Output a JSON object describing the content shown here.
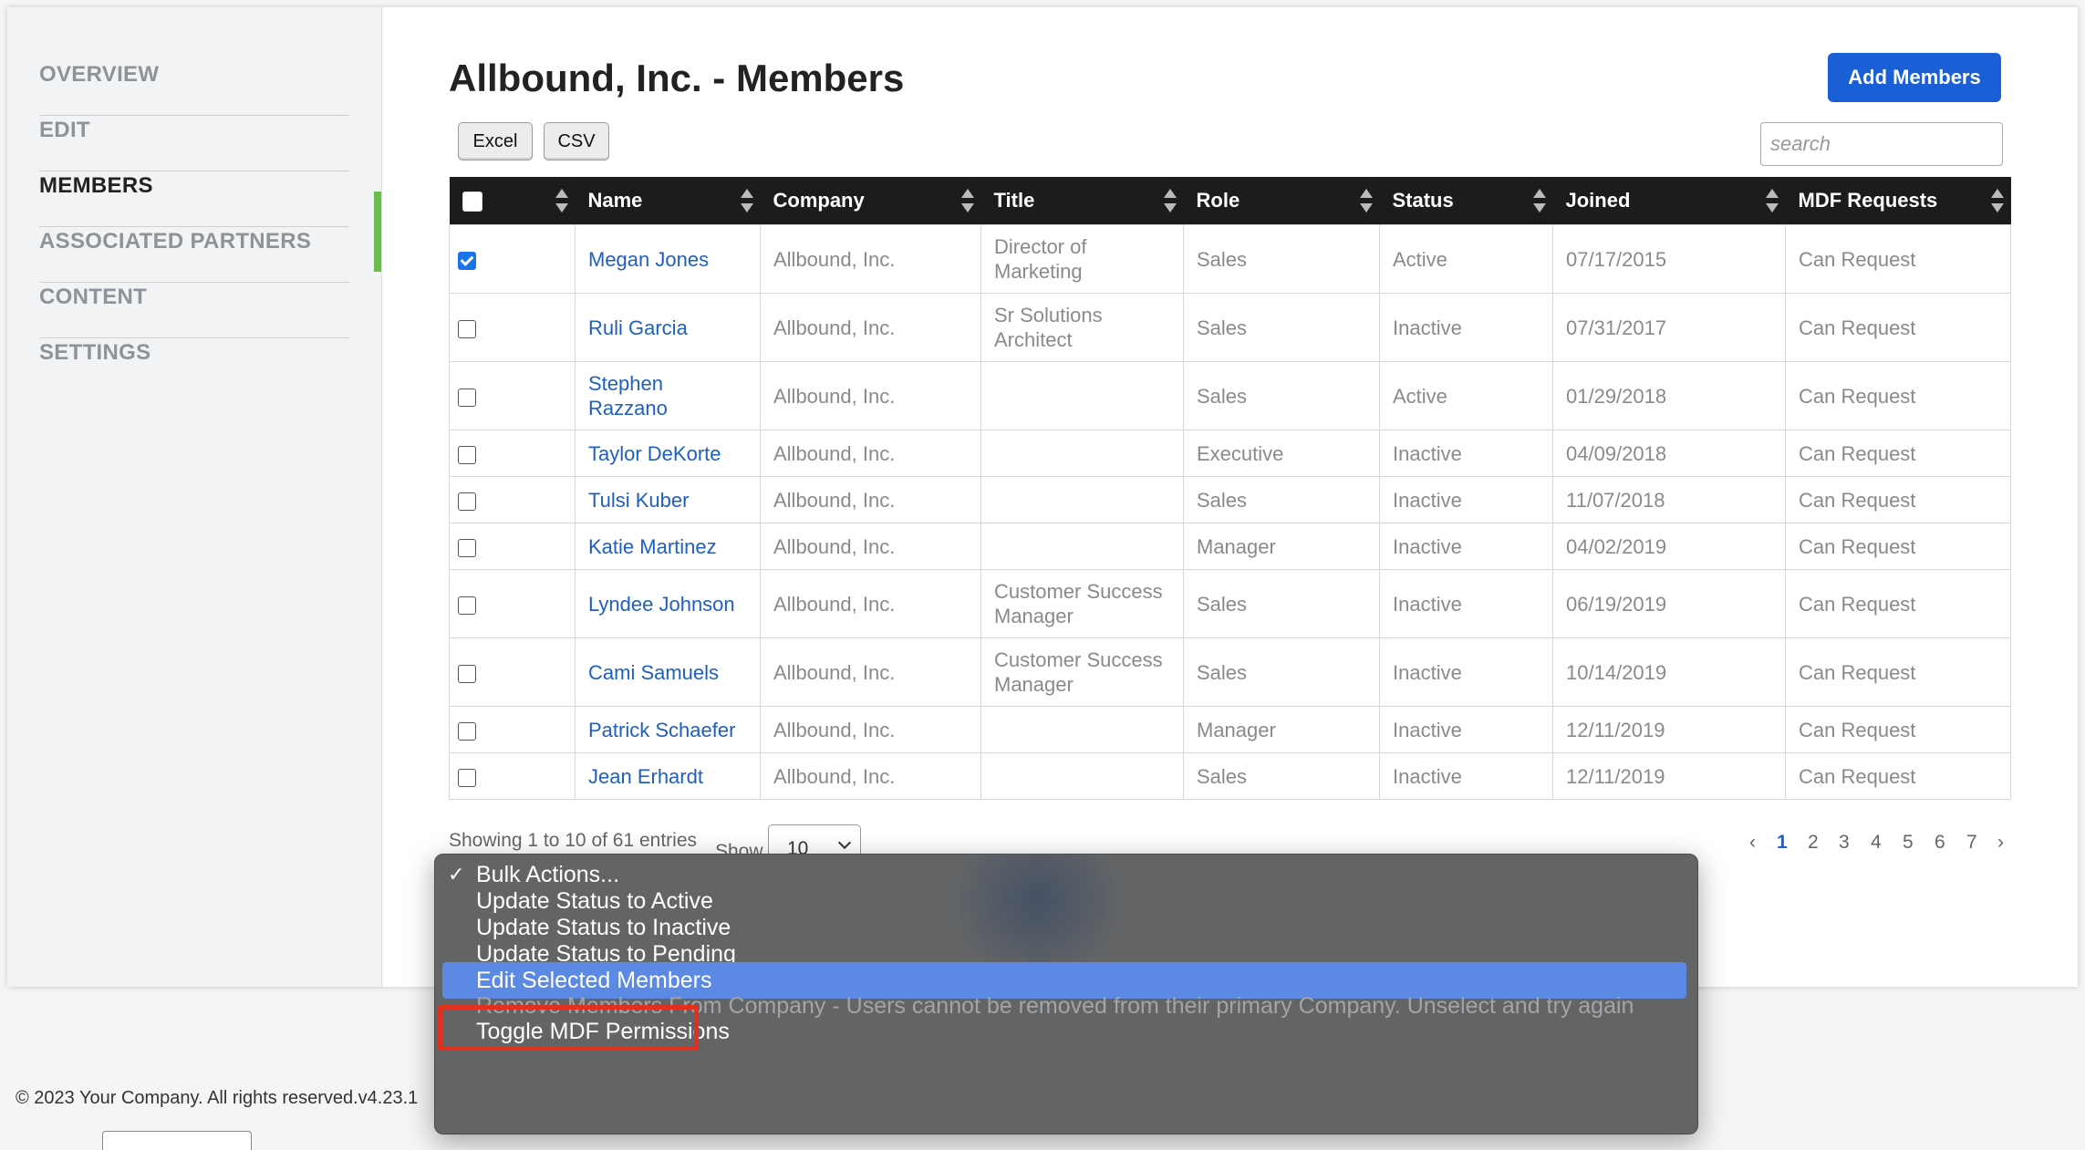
{
  "sidebar": {
    "items": [
      {
        "label": "OVERVIEW",
        "active": false
      },
      {
        "label": "EDIT",
        "active": false
      },
      {
        "label": "MEMBERS",
        "active": true
      },
      {
        "label": "ASSOCIATED PARTNERS",
        "active": false
      },
      {
        "label": "CONTENT",
        "active": false
      },
      {
        "label": "SETTINGS",
        "active": false
      }
    ]
  },
  "header": {
    "title": "Allbound, Inc. - Members",
    "add_button": "Add Members",
    "excel_button": "Excel",
    "csv_button": "CSV",
    "search_placeholder": "search"
  },
  "table": {
    "columns": [
      "Name",
      "Company",
      "Title",
      "Role",
      "Status",
      "Joined",
      "MDF Requests"
    ],
    "rows": [
      {
        "checked": true,
        "name": "Megan Jones",
        "company": "Allbound, Inc.",
        "title": "Director of Marketing",
        "role": "Sales",
        "status": "Active",
        "joined": "07/17/2015",
        "mdf": "Can Request"
      },
      {
        "checked": false,
        "name": "Ruli Garcia",
        "company": "Allbound, Inc.",
        "title": "Sr Solutions Architect",
        "role": "Sales",
        "status": "Inactive",
        "joined": "07/31/2017",
        "mdf": "Can Request"
      },
      {
        "checked": false,
        "name": "Stephen Razzano",
        "company": "Allbound, Inc.",
        "title": "",
        "role": "Sales",
        "status": "Active",
        "joined": "01/29/2018",
        "mdf": "Can Request"
      },
      {
        "checked": false,
        "name": "Taylor DeKorte",
        "company": "Allbound, Inc.",
        "title": "",
        "role": "Executive",
        "status": "Inactive",
        "joined": "04/09/2018",
        "mdf": "Can Request"
      },
      {
        "checked": false,
        "name": "Tulsi Kuber",
        "company": "Allbound, Inc.",
        "title": "",
        "role": "Sales",
        "status": "Inactive",
        "joined": "11/07/2018",
        "mdf": "Can Request"
      },
      {
        "checked": false,
        "name": "Katie Martinez",
        "company": "Allbound, Inc.",
        "title": "",
        "role": "Manager",
        "status": "Inactive",
        "joined": "04/02/2019",
        "mdf": "Can Request"
      },
      {
        "checked": false,
        "name": "Lyndee Johnson",
        "company": "Allbound, Inc.",
        "title": "Customer Success Manager",
        "role": "Sales",
        "status": "Inactive",
        "joined": "06/19/2019",
        "mdf": "Can Request"
      },
      {
        "checked": false,
        "name": "Cami Samuels",
        "company": "Allbound, Inc.",
        "title": "Customer Success Manager",
        "role": "Sales",
        "status": "Inactive",
        "joined": "10/14/2019",
        "mdf": "Can Request"
      },
      {
        "checked": false,
        "name": "Patrick Schaefer",
        "company": "Allbound, Inc.",
        "title": "",
        "role": "Manager",
        "status": "Inactive",
        "joined": "12/11/2019",
        "mdf": "Can Request"
      },
      {
        "checked": false,
        "name": "Jean Erhardt",
        "company": "Allbound, Inc.",
        "title": "",
        "role": "Sales",
        "status": "Inactive",
        "joined": "12/11/2019",
        "mdf": "Can Request"
      }
    ]
  },
  "pagination": {
    "info": "Showing 1 to 10 of 61 entries",
    "show_label": "Show",
    "show_value": "10",
    "prev": "‹",
    "next": "›",
    "pages": [
      "1",
      "2",
      "3",
      "4",
      "5",
      "6",
      "7"
    ],
    "current": "1"
  },
  "bulk_menu": {
    "items": [
      {
        "label": "Bulk Actions...",
        "checked": true,
        "state": "normal"
      },
      {
        "label": "Update Status to Active",
        "checked": false,
        "state": "normal"
      },
      {
        "label": "Update Status to Inactive",
        "checked": false,
        "state": "normal"
      },
      {
        "label": "Update Status to Pending",
        "checked": false,
        "state": "normal"
      },
      {
        "label": "Edit Selected Members",
        "checked": false,
        "state": "highlight"
      },
      {
        "label": "Remove Members From Company - Users cannot be removed from their primary Company. Unselect and try again",
        "checked": false,
        "state": "disabled"
      },
      {
        "label": "Toggle MDF Permissions",
        "checked": false,
        "state": "normal"
      }
    ],
    "tick": "✓"
  },
  "footer": {
    "text": "© 2023 Your Company. All rights reserved.v4.23.1"
  },
  "colors": {
    "accent": "#1a5fd6",
    "active_indicator": "#6dbb4a",
    "menu_highlight": "#5c89e3",
    "annotation": "#e0301e"
  }
}
